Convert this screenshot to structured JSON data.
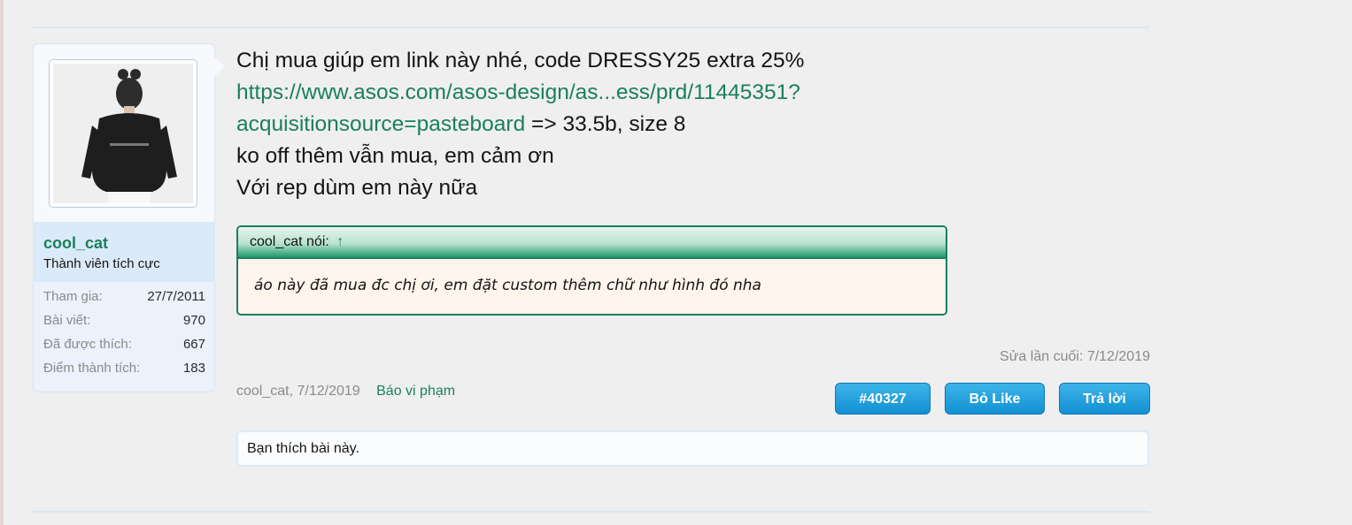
{
  "user": {
    "name": "cool_cat",
    "title": "Thành viên tích cực",
    "stats": [
      {
        "label": "Tham gia:",
        "value": "27/7/2011"
      },
      {
        "label": "Bài viết:",
        "value": "970"
      },
      {
        "label": "Đã được thích:",
        "value": "667"
      },
      {
        "label": "Điểm thành tích:",
        "value": "183"
      }
    ]
  },
  "message": {
    "line1": "Chị mua giúp em link này nhé, code DRESSY25 extra 25%",
    "link_line1": "https://www.asos.com/asos-design/as...ess/prd/11445351?",
    "link_line2": "acquisitionsource=pasteboard",
    "after_link": " => 33.5b, size 8",
    "line3": "ko off thêm vẫn mua, em cảm ơn",
    "line4": "Với rep dùm em này nữa"
  },
  "quote": {
    "author": "cool_cat nói:",
    "arrow": "↑",
    "text": "áo này đã mua đc chị ơi, em đặt custom thêm chữ như hình đó nha"
  },
  "edited": "Sửa lần cuối: 7/12/2019",
  "meta": {
    "author_date": "cool_cat, 7/12/2019",
    "report": "Báo vi phạm"
  },
  "buttons": {
    "post_number": "#40327",
    "unlike": "Bỏ Like",
    "reply": "Trả lời"
  },
  "likes": {
    "text": "Bạn thích bài này."
  },
  "colors": {
    "accent_green": "#1b7f5d",
    "button_blue": "#1190d2",
    "quote_bg": "#fff5ec"
  }
}
